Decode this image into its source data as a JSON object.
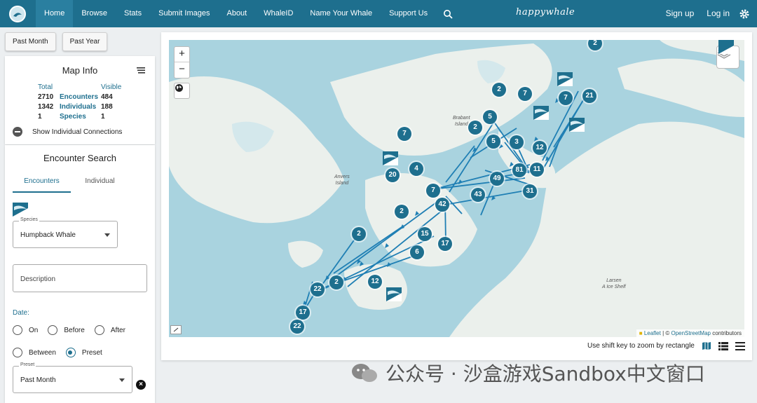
{
  "nav": {
    "items": [
      "Home",
      "Browse",
      "Stats",
      "Submit Images",
      "About",
      "WhaleID",
      "Name Your Whale",
      "Support Us"
    ],
    "brand": "happywhale",
    "signup": "Sign up",
    "login": "Log in",
    "accent": "#1e6f8e",
    "search_icon": "search-icon",
    "settings_icon": "gear-icon"
  },
  "toolbar": {
    "past_month": "Past Month",
    "past_year": "Past Year"
  },
  "map_info": {
    "title": "Map Info",
    "header_total": "Total",
    "header_visible": "Visible",
    "rows": [
      {
        "total": "2710",
        "label": "Encounters",
        "visible": "484"
      },
      {
        "total": "1342",
        "label": "Individuals",
        "visible": "188"
      },
      {
        "total": "1",
        "label": "Species",
        "visible": "1"
      }
    ],
    "show_connections": "Show Individual Connections"
  },
  "search": {
    "title": "Encounter Search",
    "tab_encounters": "Encounters",
    "tab_individual": "Individual",
    "species_label": "Species",
    "species_value": "Humpback Whale",
    "description_placeholder": "Description",
    "date_label": "Date:",
    "opt_on": "On",
    "opt_before": "Before",
    "opt_after": "After",
    "opt_between": "Between",
    "opt_preset": "Preset",
    "preset_label": "Preset",
    "preset_value": "Past Month",
    "selected_option": "Preset"
  },
  "map": {
    "zoom_in": "+",
    "zoom_out": "−",
    "labels": {
      "brabant": "Brabant\nIsland",
      "anvers": "Anvers\nIsland",
      "larsen": "Larsen\nA Ice Shelf"
    },
    "attribution_leaflet": "Leaflet",
    "attribution_sep": " | © ",
    "attribution_osm": "OpenStreetMap",
    "attribution_tail": " contributors",
    "clusters": [
      "2",
      "2",
      "7",
      "7",
      "21",
      "5",
      "2",
      "5",
      "3",
      "12",
      "7",
      "81",
      "11",
      "4",
      "49",
      "20",
      "7",
      "43",
      "31",
      "42",
      "2",
      "2",
      "15",
      "6",
      "17",
      "12",
      "2",
      "22",
      "17",
      "22"
    ],
    "footer_hint": "Use shift key to zoom by rectangle",
    "land_color": "#ebf0ec",
    "water_color": "#a9d3df"
  },
  "watermark": "公众号 · 沙盒游戏Sandbox中文窗口"
}
